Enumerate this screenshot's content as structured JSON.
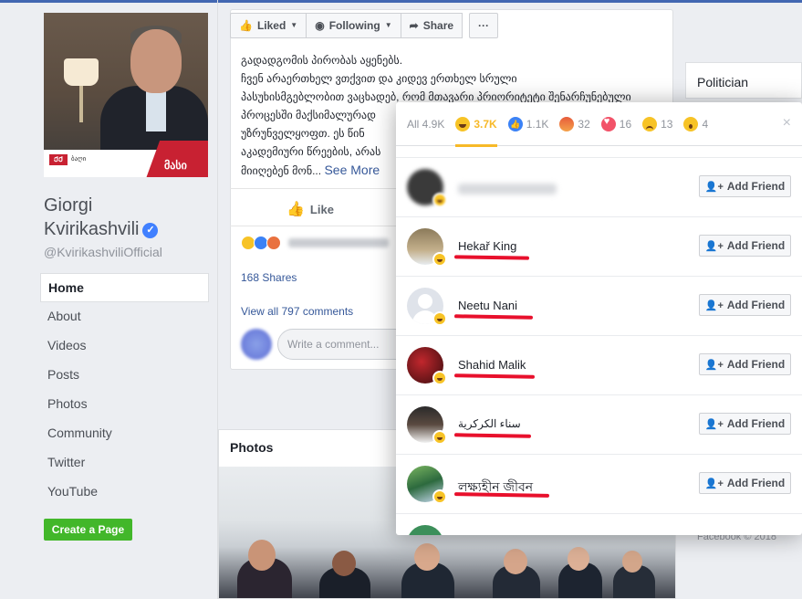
{
  "page": {
    "name_line1": "Giorgi",
    "name_line2": "Kvirikashvili",
    "handle": "@KvirikashviliOfficial",
    "verified_symbol": "✓"
  },
  "profile_picture": {
    "logo": "ᲥᲥ",
    "logo_text": "ბაღი",
    "number_mark": "მასი"
  },
  "nav": [
    {
      "label": "Home",
      "active": true
    },
    {
      "label": "About"
    },
    {
      "label": "Videos"
    },
    {
      "label": "Posts"
    },
    {
      "label": "Photos"
    },
    {
      "label": "Community"
    },
    {
      "label": "Twitter"
    },
    {
      "label": "YouTube"
    }
  ],
  "create_page_label": "Create a Page",
  "action_bar": {
    "liked": "Liked",
    "following": "Following",
    "share": "Share",
    "more": "···"
  },
  "post": {
    "lines": [
      "გადადგომის პირობას აყენებს.",
      "ჩვენ არაერთხელ ვთქვით და კიდევ ერთხელ სრული",
      "პასუხისმგებლობით ვაცხადებ, რომ მთავარი პრიორიტეტი შენარჩუნებული",
      "პროცესში მაქსიმალურად",
      "უზრუნველყოფთ. ეს წინ",
      "აკადემიური წრეების, არას",
      "მიიღებენ მონ..."
    ],
    "see_more": "See More",
    "like_label": "Like",
    "shares": "168 Shares",
    "view_comments": "View all 797 comments",
    "comment_placeholder": "Write a comment..."
  },
  "photos_card": {
    "title": "Photos"
  },
  "right_column": {
    "category": "Politician",
    "footer": "Facebook © 2018"
  },
  "popup": {
    "tabs": [
      {
        "id": "all",
        "label": "All 4.9K",
        "icon": null
      },
      {
        "id": "haha",
        "label": "3.7K",
        "icon": "haha-icon",
        "active": true
      },
      {
        "id": "like",
        "label": "1.1K",
        "icon": "like-icon"
      },
      {
        "id": "angry",
        "label": "32",
        "icon": "angry-icon"
      },
      {
        "id": "love",
        "label": "16",
        "icon": "love-icon"
      },
      {
        "id": "sad",
        "label": "13",
        "icon": "sad-icon"
      },
      {
        "id": "wow",
        "label": "4",
        "icon": "wow-icon"
      }
    ],
    "close": "×",
    "add_friend": "Add Friend",
    "rows": [
      {
        "name": "",
        "blurred": true
      },
      {
        "name": "Hekař King",
        "underline_width": 82
      },
      {
        "name": "Neetu Nani",
        "underline_width": 86
      },
      {
        "name": "Shahid Malik",
        "underline_width": 88
      },
      {
        "name": "سناء الكركرية",
        "underline_width": 84
      },
      {
        "name": "লক্ষ্যহীন জীবন",
        "underline_width": 104
      }
    ]
  },
  "colors": {
    "accent": "#4267b2",
    "link": "#365899",
    "haha": "#f7b928",
    "green": "#42b72a",
    "annotation_red": "#e8102c"
  }
}
